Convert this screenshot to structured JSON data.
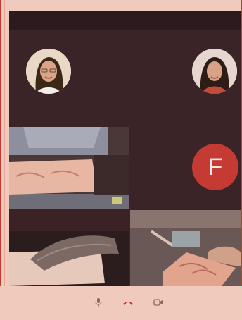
{
  "participants": {
    "letter_avatar": {
      "initial": "F",
      "color": "#c53a33"
    }
  },
  "controls": {
    "mic_icon": "microphone-icon",
    "hangup_icon": "hang-up-icon",
    "camera_icon": "camera-icon",
    "hangup_color": "#c53a33"
  },
  "colors": {
    "window_bg": "#3a2428",
    "page_bg": "#f0cbbd",
    "accent": "#c53a33"
  }
}
